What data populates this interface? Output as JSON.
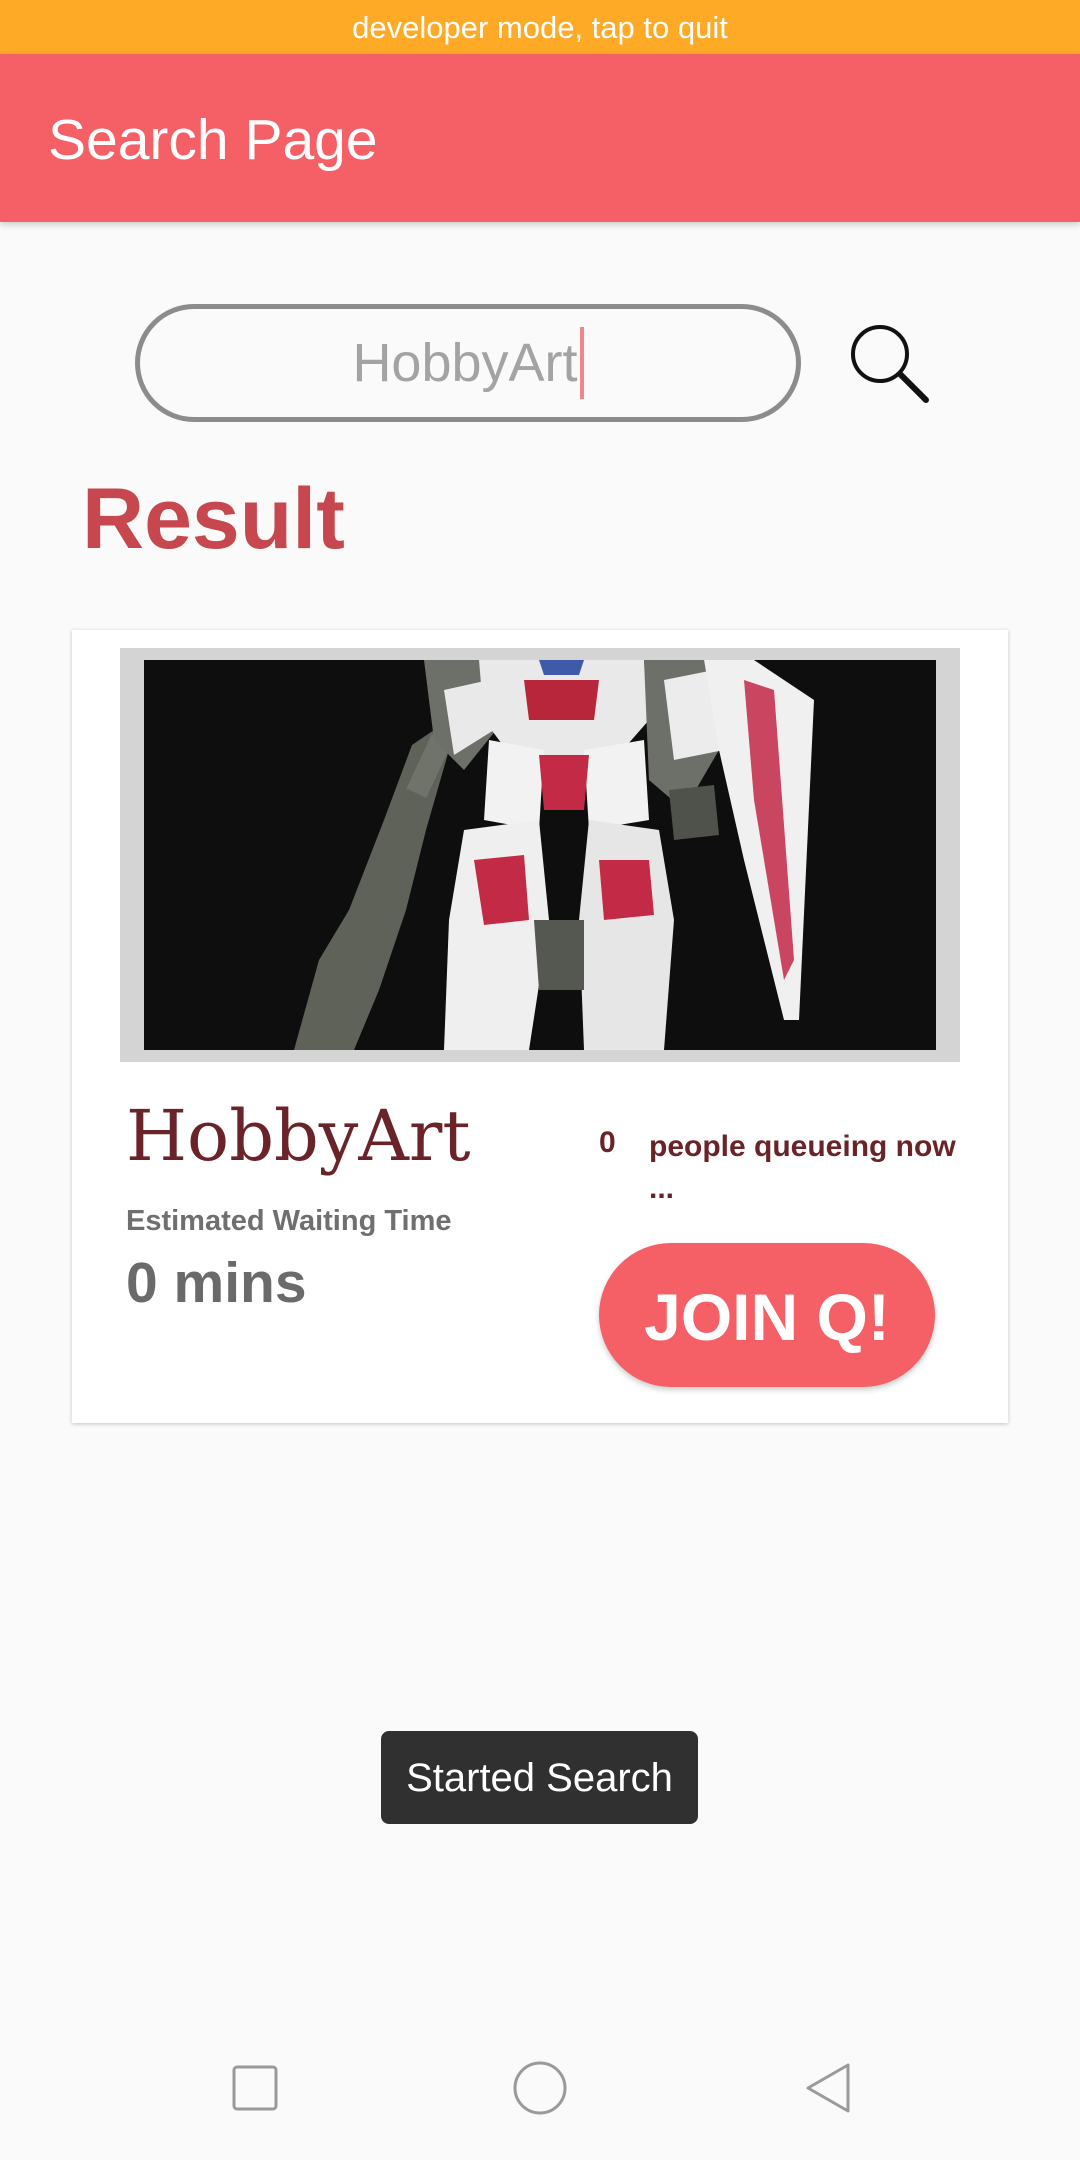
{
  "status_banner": {
    "text": "developer mode, tap to quit"
  },
  "app_bar": {
    "title": "Search Page"
  },
  "search": {
    "value": "HobbyArt",
    "icon": "search-icon"
  },
  "results": {
    "heading": "Result",
    "card": {
      "image": "robot-figure-photo",
      "name": "HobbyArt",
      "wait_label": "Estimated Waiting Time",
      "wait_value": "0 mins",
      "queue_count": "0",
      "queue_text": "people queueing now ...",
      "join_label": "JOIN Q!"
    }
  },
  "toast": {
    "text": "Started Search"
  },
  "nav_bar": {
    "recents_icon": "square-icon",
    "home_icon": "circle-icon",
    "back_icon": "triangle-back-icon"
  },
  "colors": {
    "banner": "#ffaa27",
    "app_bar": "#f55f66",
    "heading": "#c6474d",
    "shop_name": "#6a2328",
    "join_button": "#f55f66"
  }
}
